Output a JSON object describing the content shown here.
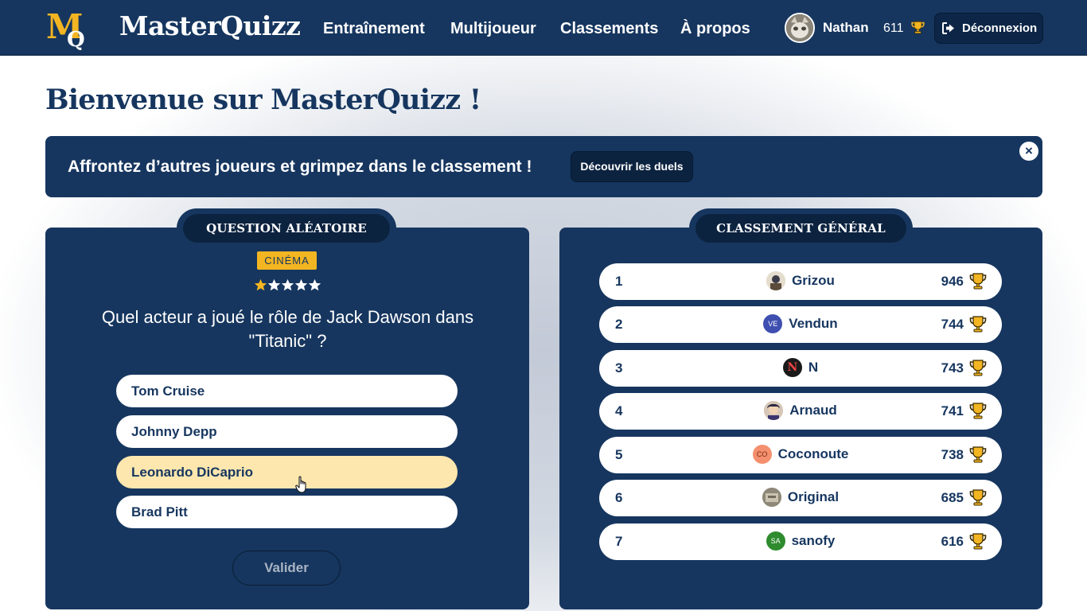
{
  "brand": {
    "name": "MasterQuizz",
    "colors": {
      "navy": "#16365f",
      "dark_navy": "#0c2340",
      "gold": "#f3b521",
      "answer_hover": "#fde7ae"
    }
  },
  "header": {
    "nav": [
      "Entraînement",
      "Multijoueur",
      "Classements",
      "À propos"
    ],
    "user": {
      "name": "Nathan",
      "score": "611"
    },
    "logout_label": "Déconnexion"
  },
  "page": {
    "title": "Bienvenue sur MasterQuizz !"
  },
  "banner": {
    "text": "Affrontez d’autres joueurs et grimpez dans le classement !",
    "button_label": "Découvrir les duels",
    "close_label": "×"
  },
  "quiz": {
    "tab_label": "QUESTION ALÉATOIRE",
    "category": "CINÉMA",
    "difficulty": {
      "filled": 1,
      "total": 5
    },
    "question": "Quel acteur a joué le rôle de Jack Dawson dans \"Titanic\" ?",
    "answers": [
      "Tom Cruise",
      "Johnny Depp",
      "Leonardo DiCaprio",
      "Brad Pitt"
    ],
    "hovered_answer": "Leonardo DiCaprio",
    "validate_label": "Valider"
  },
  "leaderboard": {
    "tab_label": "CLASSEMENT GÉNÉRAL",
    "rows": [
      {
        "rank": "1",
        "name": "Grizou",
        "score": "946",
        "avatar": "photo"
      },
      {
        "rank": "2",
        "name": "Vendun",
        "score": "744",
        "avatar": "VE"
      },
      {
        "rank": "3",
        "name": "N",
        "score": "743",
        "avatar": "N"
      },
      {
        "rank": "4",
        "name": "Arnaud",
        "score": "741",
        "avatar": "photo"
      },
      {
        "rank": "5",
        "name": "Coconoute",
        "score": "738",
        "avatar": "CO"
      },
      {
        "rank": "6",
        "name": "Original",
        "score": "685",
        "avatar": "photo"
      },
      {
        "rank": "7",
        "name": "sanofy",
        "score": "616",
        "avatar": "SA"
      }
    ]
  }
}
